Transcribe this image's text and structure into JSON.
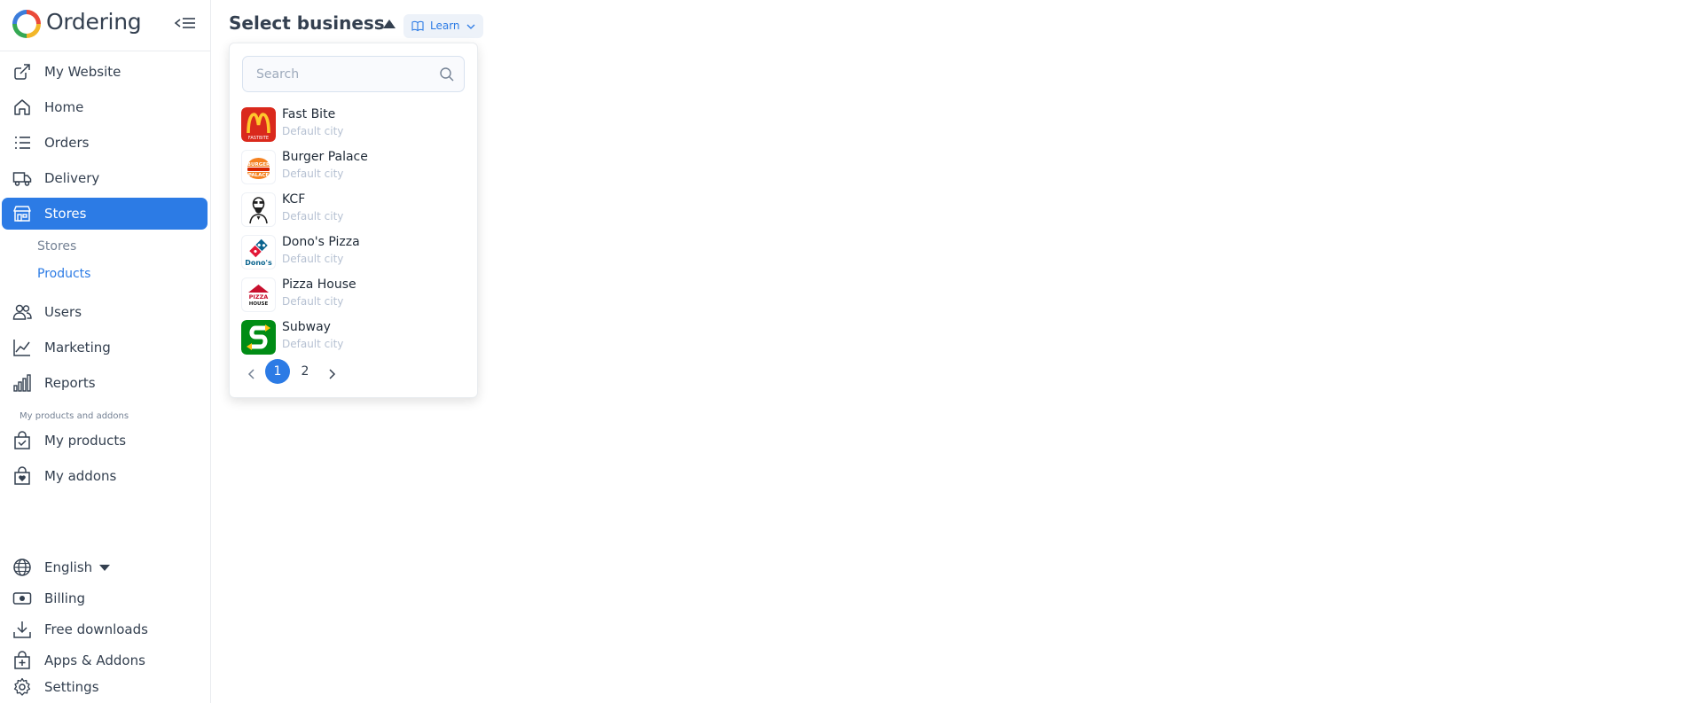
{
  "app": {
    "name": "Ordering"
  },
  "sidebar": {
    "main_items": [
      {
        "label": "My Website",
        "icon": "external-link-icon"
      },
      {
        "label": "Home",
        "icon": "home-icon"
      },
      {
        "label": "Orders",
        "icon": "list-icon"
      },
      {
        "label": "Delivery",
        "icon": "truck-icon"
      },
      {
        "label": "Stores",
        "icon": "shop-icon",
        "active": true
      },
      {
        "label": "Users",
        "icon": "users-icon"
      },
      {
        "label": "Marketing",
        "icon": "graph-up-icon"
      },
      {
        "label": "Reports",
        "icon": "bar-chart-icon"
      }
    ],
    "sub_items": [
      {
        "label": "Stores"
      },
      {
        "label": "Products",
        "active": true
      }
    ],
    "section_label": "My products and addons",
    "product_items": [
      {
        "label": "My products",
        "icon": "bag-check-icon"
      },
      {
        "label": "My addons",
        "icon": "bag-heart-icon"
      }
    ],
    "bottom_items": [
      {
        "label": "English",
        "icon": "globe-icon"
      },
      {
        "label": "Billing",
        "icon": "cash-icon"
      },
      {
        "label": "Free downloads",
        "icon": "download-icon"
      },
      {
        "label": "Apps & Addons",
        "icon": "bag-plus-icon"
      },
      {
        "label": "Settings",
        "icon": "gear-icon"
      }
    ]
  },
  "header": {
    "title": "Select business",
    "learn_label": "Learn"
  },
  "dropdown": {
    "search_placeholder": "Search",
    "businesses": [
      {
        "name": "Fast Bite",
        "city": "Default city",
        "logo": "fast-bite-logo",
        "color": "#da291c"
      },
      {
        "name": "Burger Palace",
        "city": "Default city",
        "logo": "burger-palace-logo",
        "color": "#f58220"
      },
      {
        "name": "KCF",
        "city": "Default city",
        "logo": "kcf-logo",
        "color": "#1f1f1f"
      },
      {
        "name": "Dono's Pizza",
        "city": "Default city",
        "logo": "donos-pizza-logo",
        "color": "#0b648f"
      },
      {
        "name": "Pizza House",
        "city": "Default city",
        "logo": "pizza-house-logo",
        "color": "#c8102e"
      },
      {
        "name": "Subway",
        "city": "Default city",
        "logo": "subway-logo",
        "color": "#008c15"
      }
    ],
    "pagination": {
      "pages": [
        "1",
        "2"
      ],
      "current": "1"
    }
  },
  "colors": {
    "accent": "#2c7be5",
    "text": "#344050",
    "muted": "#748194"
  }
}
